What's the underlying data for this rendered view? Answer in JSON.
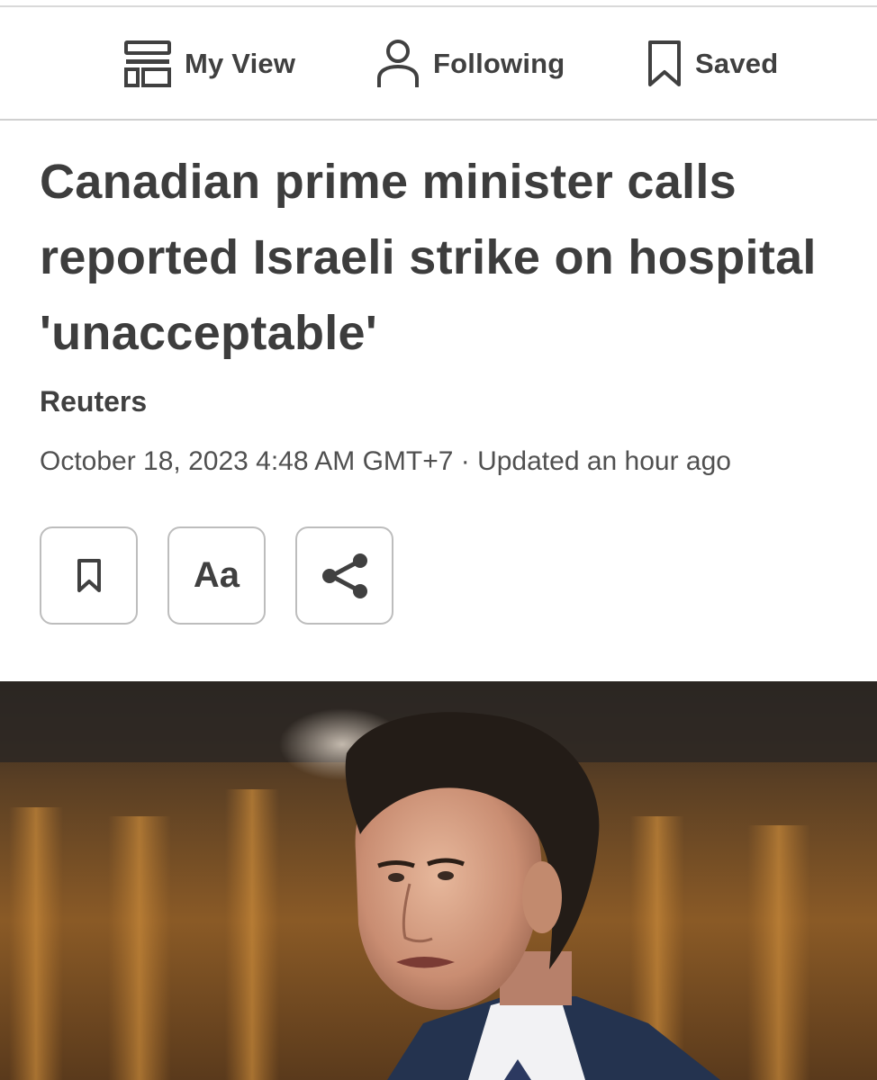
{
  "nav": {
    "my_view": {
      "label": "My View",
      "icon": "layout-icon"
    },
    "following": {
      "label": "Following",
      "icon": "person-icon"
    },
    "saved": {
      "label": "Saved",
      "icon": "bookmark-icon"
    }
  },
  "article": {
    "headline": "Canadian prime minister calls reported Israeli strike on hospital 'unacceptable'",
    "source": "Reuters",
    "dateline": "October 18, 2023 4:48 AM GMT+7 · Updated an hour ago"
  },
  "actions": {
    "bookmark_icon": "bookmark-icon",
    "text_size_label": "Aa",
    "share_icon": "share-icon"
  },
  "colors": {
    "text": "#404040",
    "border": "#bdbdbd",
    "background": "#ffffff"
  }
}
